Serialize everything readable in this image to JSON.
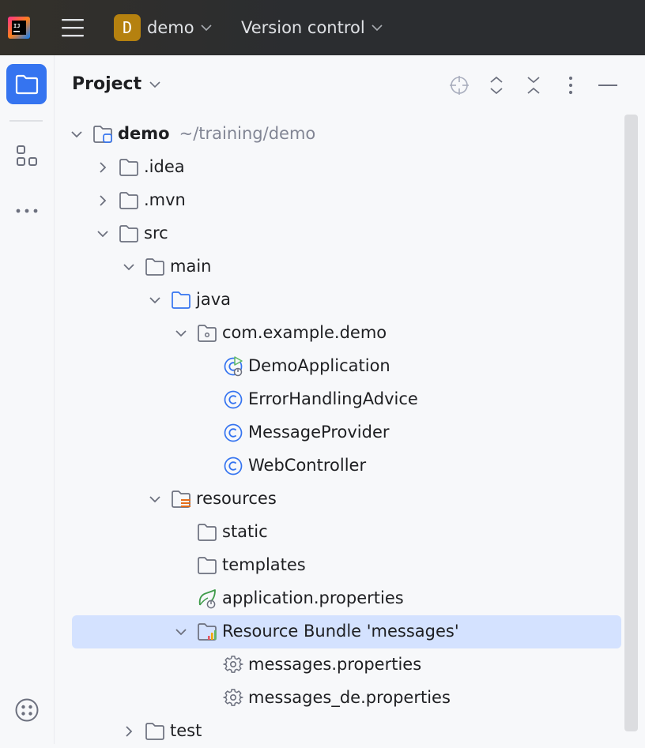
{
  "titlebar": {
    "project_avatar_letter": "D",
    "project_name": "demo",
    "vcs_label": "Version control"
  },
  "panel": {
    "title": "Project"
  },
  "tree": [
    {
      "label": "demo",
      "hint": "~/training/demo",
      "icon": "module-folder-icon",
      "arrow": "expanded",
      "depth": 0,
      "bold": true
    },
    {
      "label": ".idea",
      "icon": "folder-icon",
      "arrow": "collapsed",
      "depth": 1
    },
    {
      "label": ".mvn",
      "icon": "folder-icon",
      "arrow": "collapsed",
      "depth": 1
    },
    {
      "label": "src",
      "icon": "folder-icon",
      "arrow": "expanded",
      "depth": 1
    },
    {
      "label": "main",
      "icon": "folder-icon",
      "arrow": "expanded",
      "depth": 2
    },
    {
      "label": "java",
      "icon": "source-root-folder-icon",
      "arrow": "expanded",
      "depth": 3
    },
    {
      "label": "com.example.demo",
      "icon": "package-icon",
      "arrow": "expanded",
      "depth": 4
    },
    {
      "label": "DemoApplication",
      "icon": "spring-boot-class-icon",
      "arrow": "none",
      "depth": 5
    },
    {
      "label": "ErrorHandlingAdvice",
      "icon": "class-icon",
      "arrow": "none",
      "depth": 5
    },
    {
      "label": "MessageProvider",
      "icon": "class-icon",
      "arrow": "none",
      "depth": 5
    },
    {
      "label": "WebController",
      "icon": "class-icon",
      "arrow": "none",
      "depth": 5
    },
    {
      "label": "resources",
      "icon": "resources-root-folder-icon",
      "arrow": "expanded",
      "depth": 3
    },
    {
      "label": "static",
      "icon": "folder-icon",
      "arrow": "none",
      "depth": 4
    },
    {
      "label": "templates",
      "icon": "folder-icon",
      "arrow": "none",
      "depth": 4
    },
    {
      "label": "application.properties",
      "icon": "spring-properties-icon",
      "arrow": "none",
      "depth": 4
    },
    {
      "label": "Resource Bundle 'messages'",
      "icon": "resource-bundle-icon",
      "arrow": "expanded",
      "depth": 4,
      "selected": true
    },
    {
      "label": "messages.properties",
      "icon": "properties-gear-icon",
      "arrow": "none",
      "depth": 5
    },
    {
      "label": "messages_de.properties",
      "icon": "properties-gear-icon",
      "arrow": "none",
      "depth": 5
    },
    {
      "label": "test",
      "icon": "folder-icon",
      "arrow": "collapsed",
      "depth": 2
    }
  ],
  "colors": {
    "titlebar_bg": "#2b2d30",
    "accent": "#3574f0",
    "selection_bg": "#d4e2ff",
    "project_avatar_bg": "#b5810f",
    "hint_text": "#818594"
  }
}
